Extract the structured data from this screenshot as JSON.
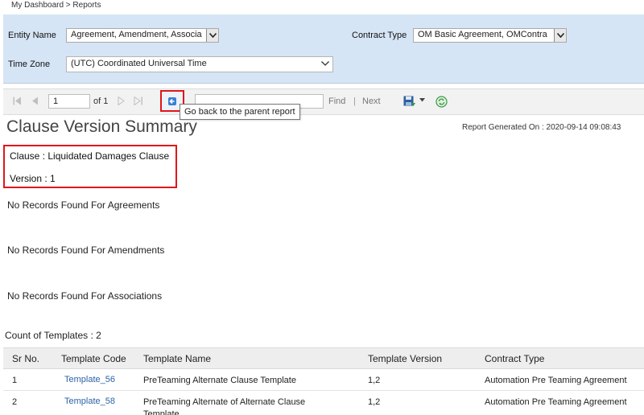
{
  "breadcrumb": "My Dashboard > Reports",
  "parameters": {
    "entity_name_label": "Entity Name",
    "entity_name_value": "Agreement, Amendment, Associa",
    "contract_type_label": "Contract Type",
    "contract_type_value": "OM Basic Agreement, OMContra",
    "time_zone_label": "Time Zone",
    "time_zone_value": "(UTC) Coordinated Universal Time"
  },
  "toolbar": {
    "page_value": "1",
    "of_pages": "of 1",
    "find_label": "Find",
    "separator": "|",
    "next_label": "Next",
    "back_tooltip": "Go back to the parent report"
  },
  "report": {
    "title": "Clause Version Summary",
    "generated_on": "Report Generated On : 2020-09-14 09:08:43",
    "clause": "Clause : Liquidated Damages Clause",
    "version": "Version : 1",
    "no_agreements": "No Records Found For Agreements",
    "no_amendments": "No Records Found For Amendments",
    "no_associations": "No Records Found For Associations",
    "count_templates": "Count of Templates : 2"
  },
  "table": {
    "headers": [
      "Sr No.",
      "Template Code",
      "Template Name",
      "Template Version",
      "Contract Type"
    ],
    "rows": [
      {
        "sr": "1",
        "code": "Template_56",
        "name": "PreTeaming Alternate Clause Template",
        "version": "1,2",
        "contract_type": "Automation Pre Teaming Agreement"
      },
      {
        "sr": "2",
        "code": "Template_58",
        "name": "PreTeaming Alternate of Alternate Clause Template",
        "version": "1,2",
        "contract_type": "Automation Pre Teaming Agreement"
      }
    ]
  },
  "icons": [
    "first-page-icon",
    "previous-page-icon",
    "next-page-icon",
    "last-page-icon",
    "back-to-parent-icon",
    "save-icon",
    "refresh-icon",
    "chevron-down-icon"
  ],
  "colors": {
    "panel_bg": "#d6e5f5",
    "highlight": "#e0151b",
    "link": "#2a63a8"
  }
}
